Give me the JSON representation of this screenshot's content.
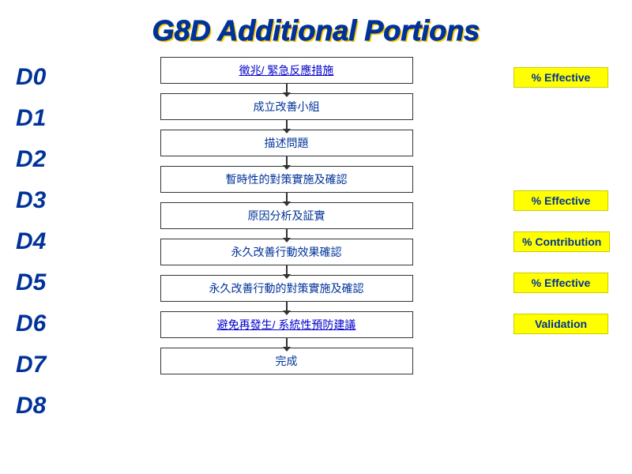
{
  "title": "G8D Additional Portions",
  "rows": [
    {
      "id": "D0",
      "label": "D0",
      "text": "徵兆/ 緊急反應措施",
      "isLink": true,
      "badge": "% Effective"
    },
    {
      "id": "D1",
      "label": "D1",
      "text": "成立改善小組",
      "isLink": false,
      "badge": ""
    },
    {
      "id": "D2",
      "label": "D2",
      "text": "描述問題",
      "isLink": false,
      "badge": ""
    },
    {
      "id": "D3",
      "label": "D3",
      "text": "暫時性的對策實施及確認",
      "isLink": false,
      "badge": "% Effective"
    },
    {
      "id": "D4",
      "label": "D4",
      "text": "原因分析及証實",
      "isLink": false,
      "badge": "% Contribution"
    },
    {
      "id": "D5",
      "label": "D5",
      "text": "永久改善行動效果確認",
      "isLink": false,
      "badge": "% Effective"
    },
    {
      "id": "D6",
      "label": "D6",
      "text": "永久改善行動的對策實施及確認",
      "isLink": false,
      "badge": "Validation"
    },
    {
      "id": "D7",
      "label": "D7",
      "text": "避免再發生/ 系統性預防建議",
      "isLink": true,
      "badge": ""
    },
    {
      "id": "D8",
      "label": "D8",
      "text": "完成",
      "isLink": false,
      "badge": ""
    }
  ]
}
